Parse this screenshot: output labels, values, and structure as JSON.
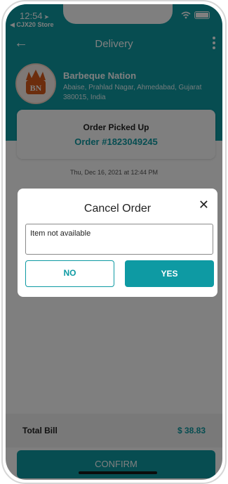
{
  "status_bar": {
    "time": "12:54",
    "back_app": "◀ CJX20 Store"
  },
  "app_bar": {
    "title": "Delivery"
  },
  "restaurant": {
    "logo_text": "BN",
    "name": "Barbeque Nation",
    "address": "Abaise, Prahlad Nagar, Ahmedabad, Gujarat 380015, India"
  },
  "order": {
    "status": "Order Picked Up",
    "number": "Order #1823049245",
    "date": "Thu, Dec 16, 2021 at 12:44 PM"
  },
  "summary": {
    "total_label": "Total Bill",
    "total_value": "$ 38.83"
  },
  "actions": {
    "confirm_label": "CONFIRM"
  },
  "modal": {
    "title": "Cancel Order",
    "reason_value": "Item not available",
    "no_label": "NO",
    "yes_label": "YES"
  },
  "colors": {
    "primary": "#0e9aa3",
    "overlay": "rgba(0,0,0,0.5)"
  }
}
